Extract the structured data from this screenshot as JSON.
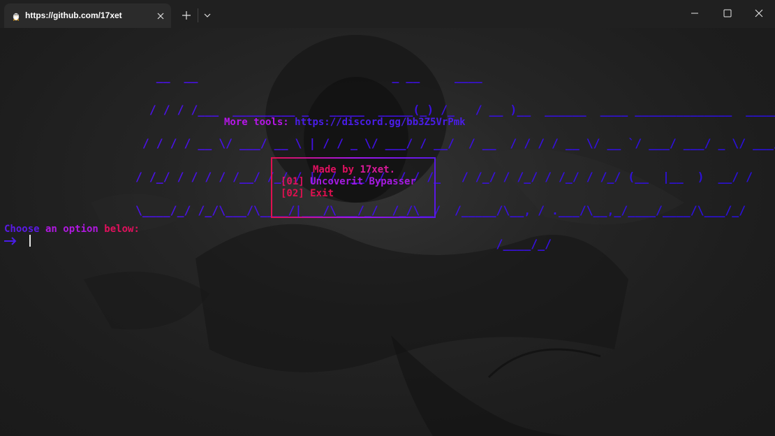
{
  "window": {
    "tab_title": "https://github.com/17xet",
    "tab_icon": "linux-penguin-icon"
  },
  "terminal": {
    "ascii_banner": [
      "   __  __                            _ __     ____                                    ",
      "  / / / /___  _________ _   _____  _____(_) /_   / __ )__  ______  ____ ______________  _____",
      " / / / / __ \\/ ___/ __ \\ | / / _ \\/ ___/ / __/  / __  / / / / __ \\/ __ `/ ___/ ___/ _ \\/ ___/",
      "/ /_/ / / / / /__/ /_/ / |/ /  __/ /  / / /_   / /_/ / /_/ / /_/ / /_/ (__  |__  )  __/ /    ",
      "\\____/_/ /_/\\___/\\____/|___/\\___/_/  /_/\\__/  /_____/\\__, / .___/\\__,_/____/____/\\___/_/     ",
      "                                                    /____/_/                                  "
    ],
    "more_tools_label": "More tools:",
    "more_tools_link": "https://discord.gg/bb3Z5VrPmk",
    "menu": {
      "made_by_prefix": "Made by ",
      "made_by_name": "17xet.",
      "option1_index": "[01]",
      "option1_label": "Uncoverit Bypasser",
      "option2_index": "[02]",
      "option2_label": "Exit"
    },
    "choose_word1": "Choose",
    "choose_word2": " an option ",
    "choose_word3": "below:",
    "prompt_symbol": "arrow-right-icon"
  },
  "colors": {
    "blue_purple": "#4a1de8",
    "purple": "#b516e8",
    "red_pink": "#e01060"
  }
}
